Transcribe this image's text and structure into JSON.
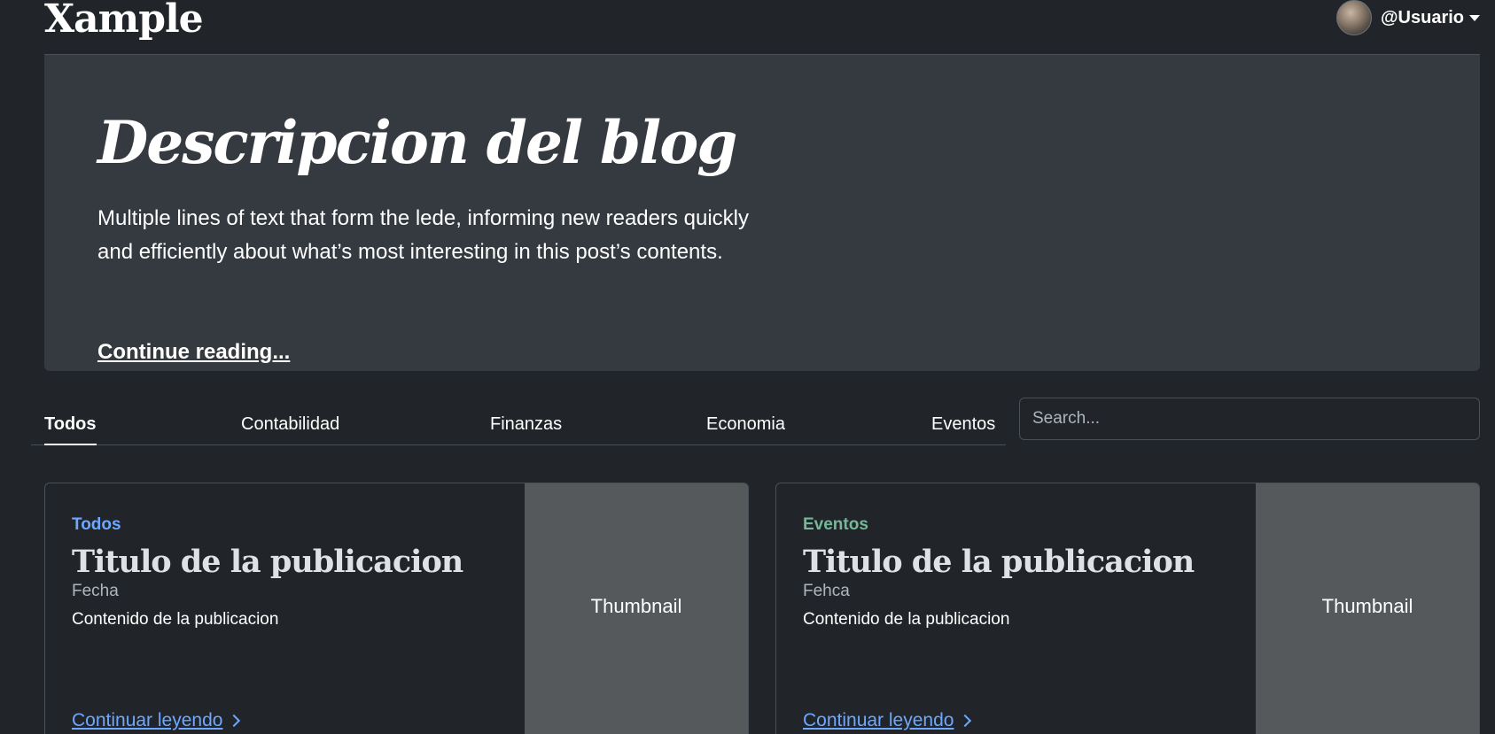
{
  "header": {
    "brand": "Xample",
    "user_name": "@Usuario"
  },
  "hero": {
    "title": "Descripcion del blog",
    "lede_line1": "Multiple lines of text that form the lede, informing new readers quickly",
    "lede_line2": "and efficiently about what’s most interesting in this post’s contents.",
    "link": "Continue reading..."
  },
  "tabs": [
    {
      "label": "Todos",
      "active": true
    },
    {
      "label": "Contabilidad"
    },
    {
      "label": "Finanzas"
    },
    {
      "label": "Economia"
    },
    {
      "label": "Eventos"
    }
  ],
  "search": {
    "placeholder": "Search..."
  },
  "cards": [
    {
      "category": "Todos",
      "category_color": "#6ea8fe",
      "title": "Titulo de la publicacion",
      "date": "Fecha",
      "content": "Contenido de la publicacion",
      "link": "Continuar leyendo",
      "thumbnail": "Thumbnail"
    },
    {
      "category": "Eventos",
      "category_color": "#75b798",
      "title": "Titulo de la publicacion",
      "date": "Fehca",
      "content": "Contenido de la publicacion",
      "link": "Continuar leyendo",
      "thumbnail": "Thumbnail"
    }
  ]
}
